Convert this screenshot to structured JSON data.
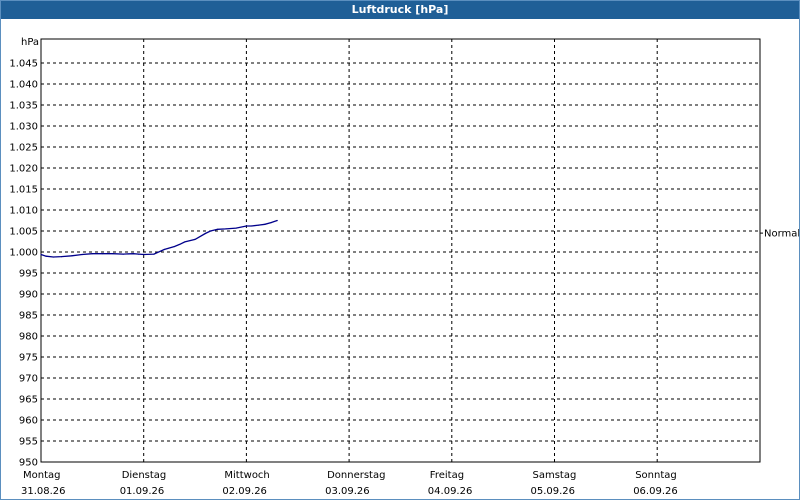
{
  "window": {
    "title": "Luftdruck [hPa]"
  },
  "chart_data": {
    "type": "line",
    "ylabel": "hPa",
    "ylim": [
      950,
      1048
    ],
    "yticks": [
      950,
      955,
      960,
      965,
      970,
      975,
      980,
      985,
      990,
      995,
      1000,
      1005,
      1010,
      1015,
      1020,
      1025,
      1030,
      1035,
      1040,
      1045
    ],
    "ytick_labels": [
      "950",
      "955",
      "960",
      "965",
      "970",
      "975",
      "980",
      "985",
      "990",
      "995",
      "1.000",
      "1.005",
      "1.010",
      "1.015",
      "1.020",
      "1.025",
      "1.030",
      "1.035",
      "1.040",
      "1.045"
    ],
    "x_categories": [
      {
        "day": "Montag",
        "date": "31.08.26"
      },
      {
        "day": "Dienstag",
        "date": "01.09.26"
      },
      {
        "day": "Mittwoch",
        "date": "02.09.26"
      },
      {
        "day": "Donnerstag",
        "date": "03.09.26"
      },
      {
        "day": "Freitag",
        "date": "04.09.26"
      },
      {
        "day": "Samstag",
        "date": "05.09.26"
      },
      {
        "day": "Sonntag",
        "date": "06.09.26"
      }
    ],
    "xlim_days": [
      0,
      7
    ],
    "grid": true,
    "reference_line": {
      "label": "Normal",
      "value": 1004.5
    },
    "line_color": "#00008b",
    "series": [
      {
        "x": [
          0.0,
          0.05,
          0.12,
          0.2,
          0.3,
          0.4,
          0.5,
          0.6,
          0.7,
          0.8,
          0.9,
          0.95,
          1.0,
          1.1,
          1.2,
          1.3,
          1.35,
          1.4,
          1.5,
          1.6,
          1.65,
          1.72,
          1.8,
          1.9,
          2.0,
          2.05,
          2.12,
          2.18,
          2.24,
          2.3
        ],
        "y": [
          999.4,
          999.0,
          998.8,
          998.9,
          999.1,
          999.4,
          999.6,
          999.6,
          999.6,
          999.5,
          999.6,
          999.5,
          999.4,
          999.5,
          1000.6,
          1001.3,
          1001.8,
          1002.4,
          1003.0,
          1004.4,
          1005.0,
          1005.4,
          1005.5,
          1005.7,
          1006.2,
          1006.2,
          1006.4,
          1006.6,
          1007.0,
          1007.5
        ]
      }
    ]
  }
}
